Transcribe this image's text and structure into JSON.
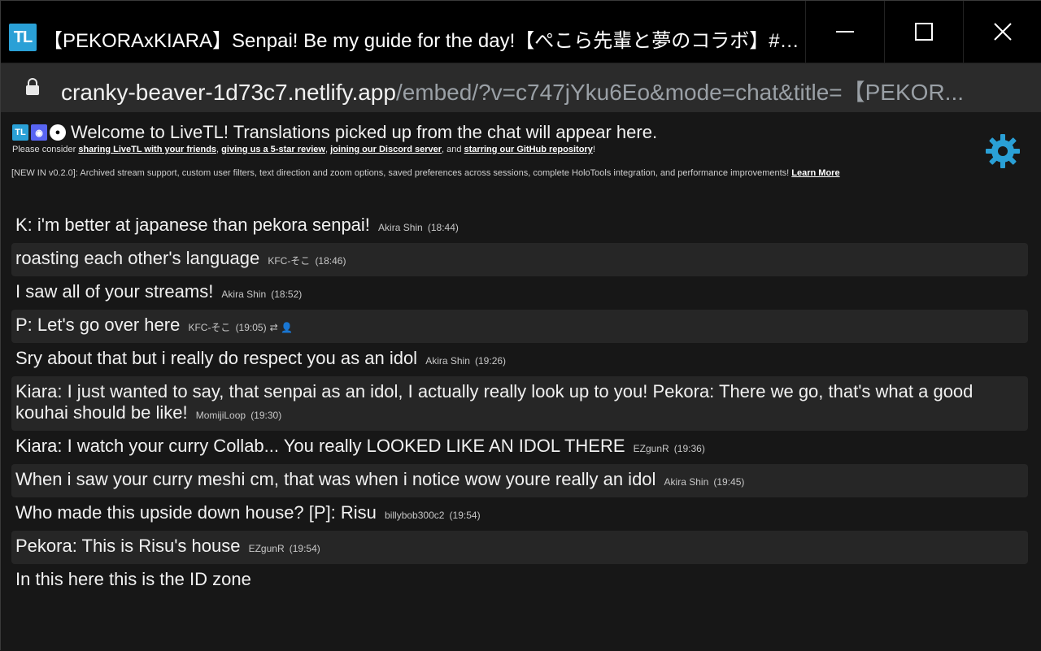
{
  "window": {
    "app_icon_text": "TL",
    "title": "【PEKORAxKIARA】Senpai! Be my guide for the day!【ぺこら先輩と夢のコラボ】#pekoki...",
    "controls": [
      "minimize-icon",
      "maximize-icon",
      "close-icon"
    ]
  },
  "address_bar": {
    "host": "cranky-beaver-1d73c7.netlify.app",
    "path": "/embed/?v=c747jYku6Eo&mode=chat&title=【PEKOR..."
  },
  "welcome": {
    "heading": "Welcome to LiveTL! Translations picked up from the chat will appear here.",
    "consider_prefix": "Please consider ",
    "link_share": "sharing LiveTL with your friends",
    "sep1": ", ",
    "link_review": "giving us a 5-star review",
    "sep2": ", ",
    "link_discord": "joining our Discord server",
    "sep3": ", and ",
    "link_github": "starring our GitHub repository",
    "suffix": "!"
  },
  "news": {
    "text": "[NEW IN v0.2.0]: Archived stream support, custom user filters, text direction and zoom options, saved preferences across sessions, complete HoloTools integration, and performance improvements! ",
    "learn_more": "Learn More"
  },
  "settings": {
    "icon": "gear-icon",
    "color": "#2aa0d6"
  },
  "messages": [
    {
      "text": "K: i'm better at japanese than pekora senpai!",
      "author": "Akira Shin",
      "time": "(18:44)",
      "extra": ""
    },
    {
      "text": "roasting each other's language",
      "author": "KFC-そこ",
      "time": "(18:46)",
      "extra": ""
    },
    {
      "text": "I saw all of your streams!",
      "author": "Akira Shin",
      "time": "(18:52)",
      "extra": ""
    },
    {
      "text": "P: Let's go over here",
      "author": "KFC-そこ",
      "time": "(19:05)",
      "extra": "⇄ 👤"
    },
    {
      "text": "Sry about that but i really do respect you as an idol",
      "author": "Akira Shin",
      "time": "(19:26)",
      "extra": ""
    },
    {
      "text": "Kiara: I just wanted to say, that senpai as an idol, I actually really look up to you! Pekora: There we go, that's what a good kouhai should be like!",
      "author": "MomijiLoop",
      "time": "(19:30)",
      "extra": ""
    },
    {
      "text": "Kiara: I watch your curry Collab... You really LOOKED LIKE AN IDOL THERE",
      "author": "EZgunR",
      "time": "(19:36)",
      "extra": ""
    },
    {
      "text": "When i saw your curry meshi cm, that was when i notice wow youre really an idol",
      "author": "Akira Shin",
      "time": "(19:45)",
      "extra": ""
    },
    {
      "text": "Who made this upside down house? [P]: Risu",
      "author": "billybob300c2",
      "time": "(19:54)",
      "extra": ""
    },
    {
      "text": "Pekora: This is Risu's house",
      "author": "EZgunR",
      "time": "(19:54)",
      "extra": ""
    },
    {
      "text": "In this here this is the ID zone",
      "author": "",
      "time": "",
      "extra": ""
    }
  ]
}
